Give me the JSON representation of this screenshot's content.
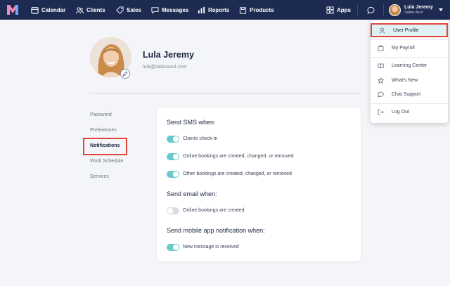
{
  "nav": {
    "items": [
      {
        "label": "Calendar",
        "icon": "calendar-icon"
      },
      {
        "label": "Clients",
        "icon": "clients-icon"
      },
      {
        "label": "Sales",
        "icon": "tag-icon"
      },
      {
        "label": "Messages",
        "icon": "chat-icon"
      },
      {
        "label": "Reports",
        "icon": "bar-chart-icon"
      },
      {
        "label": "Products",
        "icon": "box-icon"
      }
    ],
    "apps_label": "Apps",
    "user_name": "Lula Jeremy",
    "user_salon": "Salon Azul"
  },
  "profile": {
    "name": "Lula Jeremy",
    "email": "lula@salonazul.com"
  },
  "menu": {
    "items": [
      "Password",
      "Preferences",
      "Notifications",
      "Work Schedule",
      "Services"
    ],
    "active": "Notifications"
  },
  "notifications": {
    "sms_title": "Send SMS when:",
    "sms_options": [
      {
        "label": "Clients check-in",
        "on": true
      },
      {
        "label": "Online bookings are created, changed, or removed",
        "on": true
      },
      {
        "label": "Other bookings are created, changed, or removed",
        "on": true
      }
    ],
    "email_title": "Send email when:",
    "email_options": [
      {
        "label": "Online bookings are created",
        "on": false
      }
    ],
    "app_title": "Send mobile app notification when:",
    "app_options": [
      {
        "label": "New message is received",
        "on": true
      }
    ]
  },
  "dropdown": {
    "items": [
      "User Profile",
      "My Payroll",
      "Learning Center",
      "What's New",
      "Chat Support",
      "Log Out"
    ],
    "selected": "User Profile"
  },
  "colors": {
    "nav_bg": "#1d2b52",
    "toggle_on": "#6cc9cb",
    "highlight": "#e0473c"
  }
}
